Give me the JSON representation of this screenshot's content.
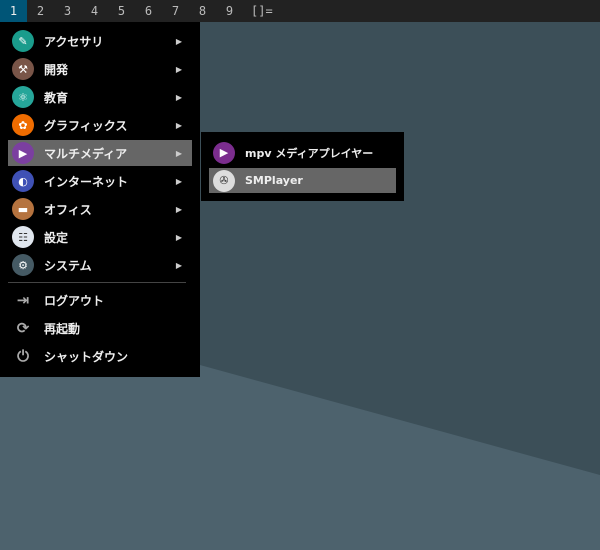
{
  "topbar": {
    "workspaces": [
      "1",
      "2",
      "3",
      "4",
      "5",
      "6",
      "7",
      "8",
      "9"
    ],
    "active": "1",
    "layout": "[]="
  },
  "menu": {
    "items": [
      {
        "label": "アクセサリ",
        "icon": "accessories-icon",
        "color": "#1a9c8c"
      },
      {
        "label": "開発",
        "icon": "development-icon",
        "color": "#795548"
      },
      {
        "label": "教育",
        "icon": "education-icon",
        "color": "#26a69a"
      },
      {
        "label": "グラフィックス",
        "icon": "graphics-icon",
        "color": "#ef6c00"
      },
      {
        "label": "マルチメディア",
        "icon": "multimedia-icon",
        "color": "#7b3fa0"
      },
      {
        "label": "インターネット",
        "icon": "internet-icon",
        "color": "#3f51b5"
      },
      {
        "label": "オフィス",
        "icon": "office-icon",
        "color": "#b5733f"
      },
      {
        "label": "設定",
        "icon": "settings-icon",
        "color": "#e0e6ee"
      },
      {
        "label": "システム",
        "icon": "system-icon",
        "color": "#455a64"
      }
    ],
    "actions": [
      {
        "label": "ログアウト",
        "icon": "logout-icon"
      },
      {
        "label": "再起動",
        "icon": "restart-icon"
      },
      {
        "label": "シャットダウン",
        "icon": "shutdown-icon"
      }
    ],
    "selected": "マルチメディア",
    "arrow": "▶"
  },
  "submenu": {
    "items": [
      {
        "label": "mpv メディアプレイヤー",
        "icon": "mpv-icon",
        "color": "#7b2d8e"
      },
      {
        "label": "SMPlayer",
        "icon": "smplayer-icon",
        "color": "#ddd"
      }
    ],
    "selected": "SMPlayer"
  }
}
